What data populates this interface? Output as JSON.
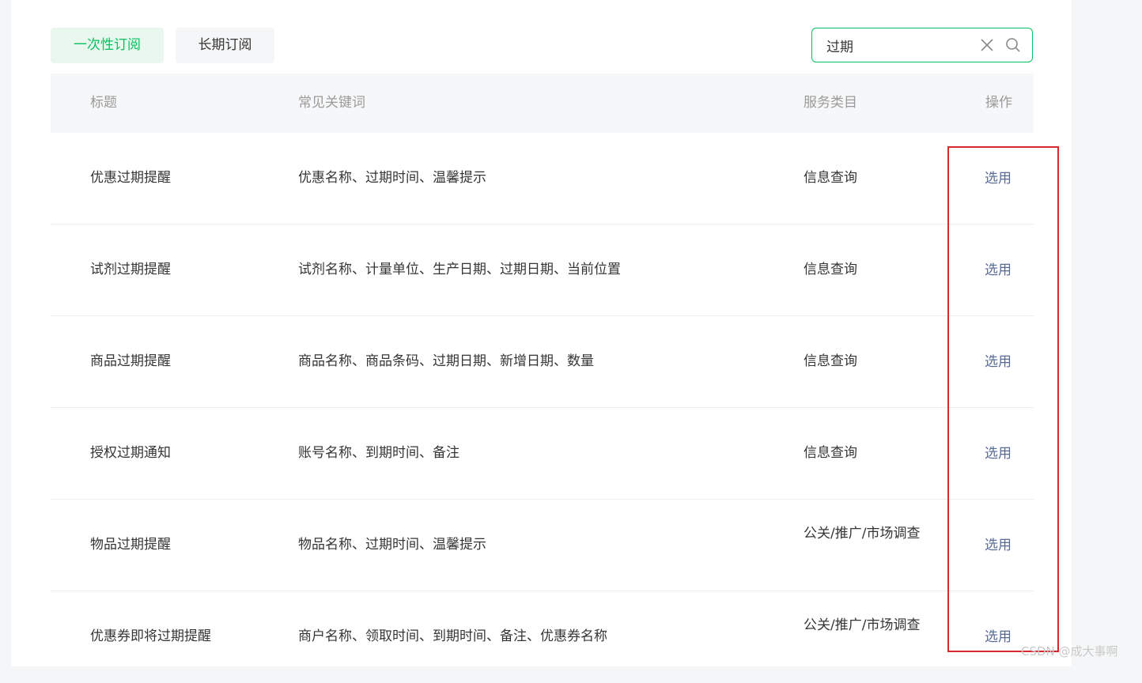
{
  "tabs": {
    "once_label": "一次性订阅",
    "long_label": "长期订阅"
  },
  "search": {
    "value": "过期",
    "icon_clear": "close-icon",
    "icon_search": "search-icon"
  },
  "table": {
    "headers": {
      "title": "标题",
      "keywords": "常见关键词",
      "category": "服务类目",
      "action": "操作"
    },
    "rows": [
      {
        "title": "优惠过期提醒",
        "keywords": "优惠名称、过期时间、温馨提示",
        "category": "信息查询",
        "action": "选用"
      },
      {
        "title": "试剂过期提醒",
        "keywords": "试剂名称、计量单位、生产日期、过期日期、当前位置",
        "category": "信息查询",
        "action": "选用"
      },
      {
        "title": "商品过期提醒",
        "keywords": "商品名称、商品条码、过期日期、新增日期、数量",
        "category": "信息查询",
        "action": "选用"
      },
      {
        "title": "授权过期通知",
        "keywords": "账号名称、到期时间、备注",
        "category": "信息查询",
        "action": "选用"
      },
      {
        "title": "物品过期提醒",
        "keywords": "物品名称、过期时间、温馨提示",
        "category": "公关/推广/市场调查",
        "action": "选用"
      },
      {
        "title": "优惠券即将过期提醒",
        "keywords": "商户名称、领取时间、到期时间、备注、优惠券名称",
        "category": "公关/推广/市场调查",
        "action": "选用"
      }
    ]
  },
  "watermark": "CSDN @成大事啊",
  "colors": {
    "accent": "#07c160",
    "link": "#576b95",
    "highlight": "#d9272e"
  }
}
